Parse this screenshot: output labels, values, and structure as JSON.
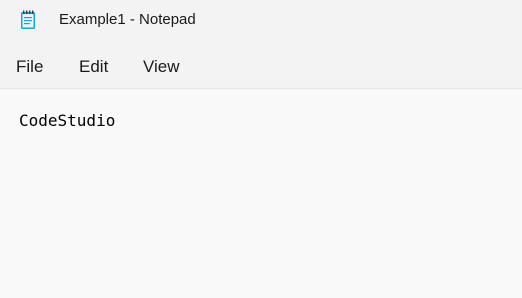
{
  "window": {
    "title": "Example1 - Notepad",
    "icon": "notepad-icon"
  },
  "menu": {
    "items": [
      {
        "label": "File"
      },
      {
        "label": "Edit"
      },
      {
        "label": "View"
      }
    ]
  },
  "editor": {
    "content": "CodeStudio"
  },
  "colors": {
    "titlebar_bg": "#f3f3f3",
    "editor_bg": "#f9f9f9",
    "icon_accent": "#1aa5d6"
  }
}
